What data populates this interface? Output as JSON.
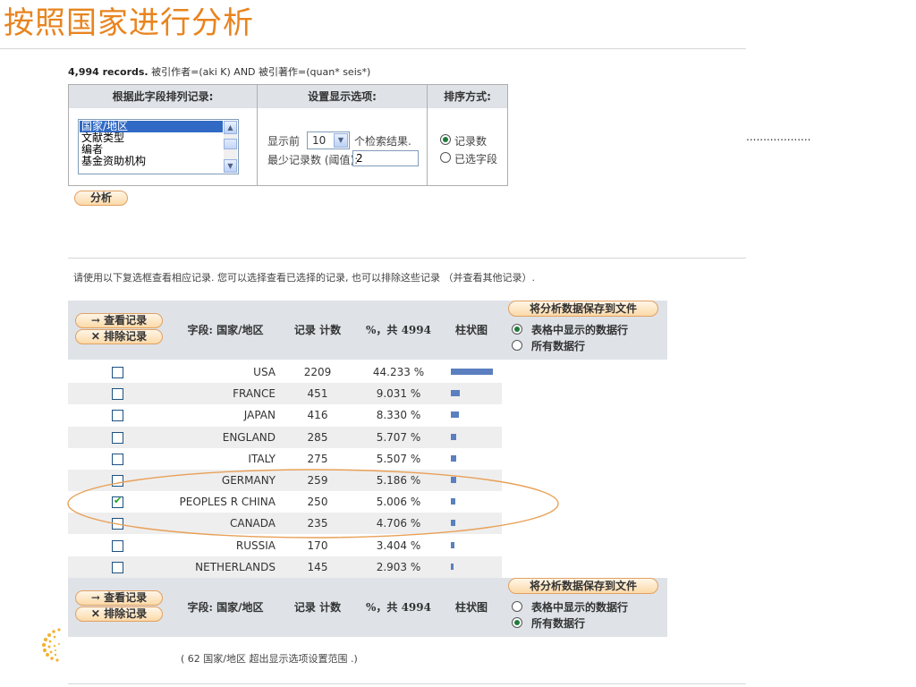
{
  "title": "按照国家进行分析",
  "query": {
    "count": "4,994 records.",
    "text": "被引作者=(aki K) AND 被引著作=(quan* seis*)"
  },
  "options": {
    "col1_header": "根据此字段排列记录:",
    "col2_header": "设置显示选项:",
    "col3_header": "排序方式:",
    "field_list": [
      "国家/地区",
      "文献类型",
      "编者",
      "基金资助机构"
    ],
    "selected_field": "国家/地区",
    "show_prefix": "显示前",
    "show_value": "10",
    "show_suffix": "个检索结果.",
    "min_label": "最少记录数 (阈值):",
    "min_value": "2",
    "sort_options": [
      {
        "label": "记录数",
        "selected": true
      },
      {
        "label": "已选字段",
        "selected": false
      }
    ],
    "analyze_label": "分析"
  },
  "dots": "...................",
  "instructions": "请使用以下复选框查看相应记录. 您可以选择查看已选择的记录, 也可以排除这些记录 （并查看其他记录）.",
  "table": {
    "view_records": "→ 查看记录",
    "exclude_records": "✕ 排除记录",
    "col_field": "字段: 国家/地区",
    "col_count": "记录 计数",
    "col_percent": "%，共 4994",
    "col_bar": "柱状图",
    "save_label": "将分析数据保存到文件",
    "save_opt1": "表格中显示的数据行",
    "save_opt2": "所有数据行",
    "save_selected_top": 1,
    "save_selected_bottom": 0,
    "rows": [
      {
        "country": "USA",
        "count": "2209",
        "percent": "44.233 %",
        "checked": false
      },
      {
        "country": "FRANCE",
        "count": "451",
        "percent": "9.031 %",
        "checked": false
      },
      {
        "country": "JAPAN",
        "count": "416",
        "percent": "8.330 %",
        "checked": false
      },
      {
        "country": "ENGLAND",
        "count": "285",
        "percent": "5.707 %",
        "checked": false
      },
      {
        "country": "ITALY",
        "count": "275",
        "percent": "5.507 %",
        "checked": false
      },
      {
        "country": "GERMANY",
        "count": "259",
        "percent": "5.186 %",
        "checked": false
      },
      {
        "country": "PEOPLES R CHINA",
        "count": "250",
        "percent": "5.006 %",
        "checked": true
      },
      {
        "country": "CANADA",
        "count": "235",
        "percent": "4.706 %",
        "checked": false
      },
      {
        "country": "RUSSIA",
        "count": "170",
        "percent": "3.404 %",
        "checked": false
      },
      {
        "country": "NETHERLANDS",
        "count": "145",
        "percent": "2.903 %",
        "checked": false
      }
    ]
  },
  "footnote": "( 62 国家/地区  超出显示选项设置范围 .)",
  "colors": {
    "title": "#e8841f",
    "bar": "#5b7fbf",
    "header_bg": "#dfe3e8",
    "highlight_ellipse": "#e8a058"
  },
  "highlight_row_index": 6
}
